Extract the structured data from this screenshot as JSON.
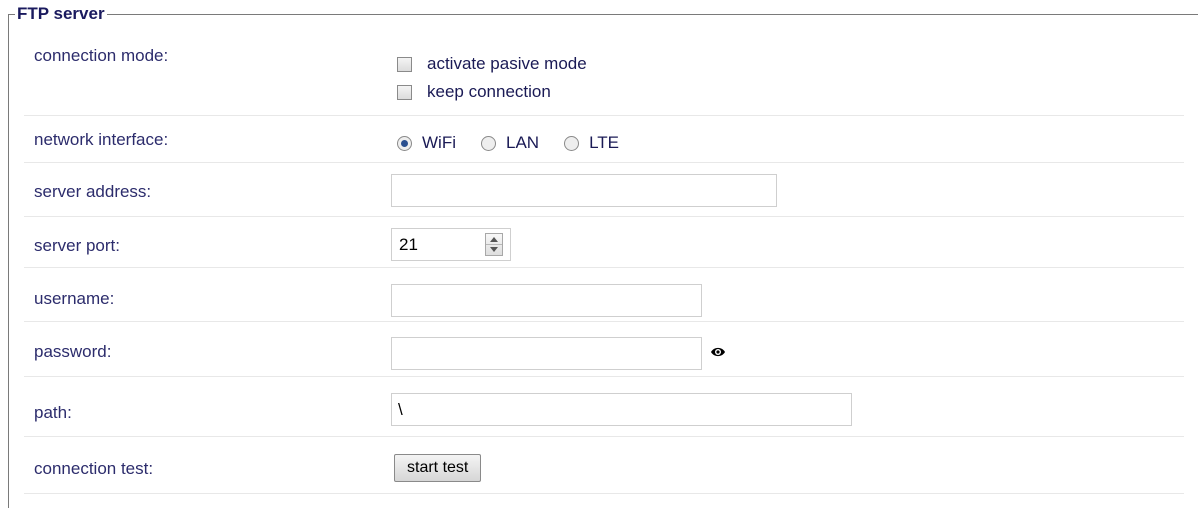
{
  "section": {
    "title": "FTP server"
  },
  "connection_mode": {
    "label": "connection mode:",
    "options": [
      {
        "label": "activate pasive mode",
        "checked": false
      },
      {
        "label": "keep connection",
        "checked": false
      }
    ]
  },
  "network_interface": {
    "label": "network interface:",
    "options": [
      {
        "label": "WiFi",
        "selected": true
      },
      {
        "label": "LAN",
        "selected": false
      },
      {
        "label": "LTE",
        "selected": false
      }
    ]
  },
  "server_address": {
    "label": "server address:",
    "value": ""
  },
  "server_port": {
    "label": "server port:",
    "value": "21"
  },
  "username": {
    "label": "username:",
    "value": ""
  },
  "password": {
    "label": "password:",
    "value": "",
    "toggle_icon": "eye-icon"
  },
  "path": {
    "label": "path:",
    "value": "\\"
  },
  "connection_test": {
    "label": "connection test:",
    "button_label": "start test"
  }
}
